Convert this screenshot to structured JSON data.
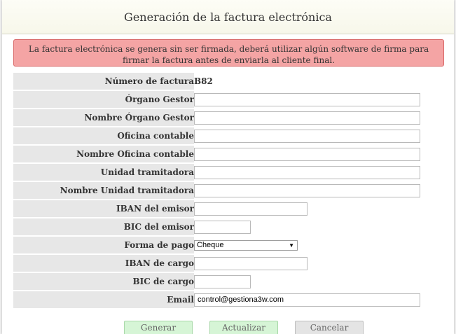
{
  "dialog": {
    "title": "Generación de la factura electrónica"
  },
  "alert": {
    "text": "La factura electrónica se genera sin ser firmada, deberá utilizar algún software de firma para firmar la factura antes de enviarla al cliente final.",
    "color": "#f4a4a4"
  },
  "form": {
    "numero_factura": {
      "label": "Número de factura",
      "value": "B82"
    },
    "organo_gestor": {
      "label": "Órgano Gestor",
      "value": ""
    },
    "nombre_organo_gestor": {
      "label": "Nombre Órgano Gestor",
      "value": ""
    },
    "oficina_contable": {
      "label": "Oficina contable",
      "value": ""
    },
    "nombre_oficina_contable": {
      "label": "Nombre Oficina contable",
      "value": ""
    },
    "unidad_tramitadora": {
      "label": "Unidad tramitadora",
      "value": ""
    },
    "nombre_unidad_tramitadora": {
      "label": "Nombre Unidad tramitadora",
      "value": ""
    },
    "iban_emisor": {
      "label": "IBAN del emisor",
      "value": ""
    },
    "bic_emisor": {
      "label": "BIC del emisor",
      "value": ""
    },
    "forma_pago": {
      "label": "Forma de pago",
      "value": "Cheque"
    },
    "iban_cargo": {
      "label": "IBAN de cargo",
      "value": ""
    },
    "bic_cargo": {
      "label": "BIC de cargo",
      "value": ""
    },
    "email": {
      "label": "Email",
      "value": "control@gestiona3w.com"
    }
  },
  "buttons": {
    "generar": "Generar",
    "actualizar": "Actualizar",
    "cancelar": "Cancelar"
  }
}
